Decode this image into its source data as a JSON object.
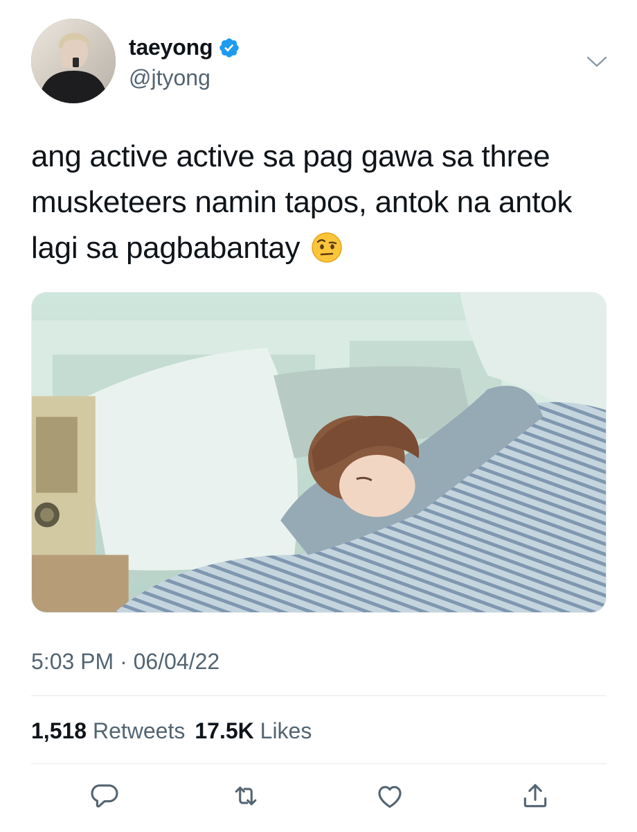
{
  "user": {
    "display_name": "taeyong",
    "handle": "@jtyong"
  },
  "tweet": {
    "text": "ang active active sa pag gawa sa three musketeers namin tapos, antok na antok lagi sa pagbabantay",
    "emoji": "raised-eyebrow-emoji",
    "timestamp": "5:03 PM · 06/04/22"
  },
  "stats": {
    "retweets_count": "1,518",
    "retweets_label": "Retweets",
    "likes_count": "17.5K",
    "likes_label": "Likes"
  },
  "colors": {
    "verified_blue": "#1d9bf0",
    "secondary_text": "#536471",
    "primary_text": "#0f1419"
  }
}
